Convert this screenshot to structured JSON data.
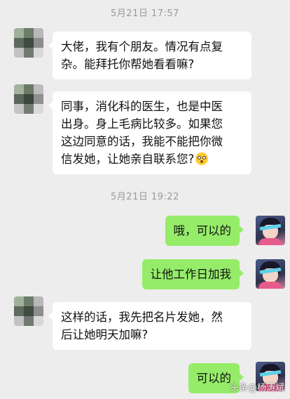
{
  "chat": {
    "timestamp_1": "5月21日 17:57",
    "timestamp_2": "5月21日 19:22",
    "messages": [
      {
        "side": "left",
        "lines": [
          "大佬，我有个朋友。情况有点复",
          "杂。能拜托你帮她看看嘛?"
        ]
      },
      {
        "side": "left",
        "lines": [
          "同事，消化科的医生，也是中医",
          "出身。身上毛病比较多。如果您",
          "这边同意的话，我能不能把你微",
          "信发她，让她亲自联系您?"
        ],
        "emoji": "flushed-face"
      },
      {
        "side": "right",
        "text": "哦，可以的"
      },
      {
        "side": "right",
        "text": "让他工作日加我"
      },
      {
        "side": "left",
        "lines": [
          "这样的话，我先把名片发她，然",
          "后让她明天加嘛?"
        ]
      },
      {
        "side": "right",
        "text": "可以的"
      }
    ]
  },
  "watermark": "头条@杨涛斌",
  "colors": {
    "background": "#ededed",
    "bubble_left": "#ffffff",
    "bubble_right": "#95ec69",
    "timestamp": "#9a9a9a"
  }
}
